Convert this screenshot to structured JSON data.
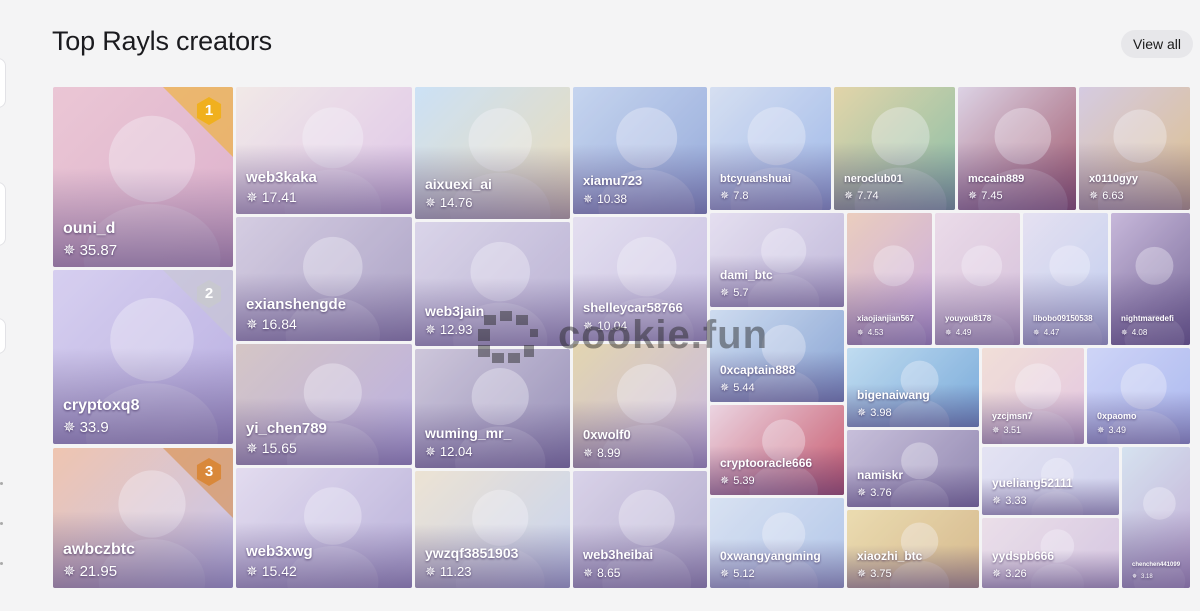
{
  "header": {
    "title": "Top Rayls creators",
    "view_all_label": "View all"
  },
  "watermark": {
    "text": "cookie.fun"
  },
  "ranks": {
    "first": "1",
    "second": "2",
    "third": "3"
  },
  "icons": {
    "score": "cog-icon"
  },
  "colors": {
    "tile_tint": "#c9b8ee",
    "gold": "#f0b01e",
    "silver": "#c8c8d0",
    "bronze": "#d9883a"
  },
  "creators": [
    {
      "name": "ouni_d",
      "score": "35.87"
    },
    {
      "name": "cryptoxq8",
      "score": "33.9"
    },
    {
      "name": "awbczbtc",
      "score": "21.95"
    },
    {
      "name": "web3kaka",
      "score": "17.41"
    },
    {
      "name": "exianshengde",
      "score": "16.84"
    },
    {
      "name": "yi_chen789",
      "score": "15.65"
    },
    {
      "name": "web3xwg",
      "score": "15.42"
    },
    {
      "name": "aixuexi_ai",
      "score": "14.76"
    },
    {
      "name": "web3jain",
      "score": "12.93"
    },
    {
      "name": "wuming_mr_",
      "score": "12.04"
    },
    {
      "name": "ywzqf3851903",
      "score": "11.23"
    },
    {
      "name": "xiamu723",
      "score": "10.38"
    },
    {
      "name": "shelleycar58766",
      "score": "10.04"
    },
    {
      "name": "0xwolf0",
      "score": "8.99"
    },
    {
      "name": "web3heibai",
      "score": "8.65"
    },
    {
      "name": "btcyuanshuai",
      "score": "7.8"
    },
    {
      "name": "dami_btc",
      "score": "5.7"
    },
    {
      "name": "0xcaptain888",
      "score": "5.44"
    },
    {
      "name": "cryptooracle666",
      "score": "5.39"
    },
    {
      "name": "0xwangyangming",
      "score": "5.12"
    },
    {
      "name": "neroclub01",
      "score": "7.74"
    },
    {
      "name": "mccain889",
      "score": "7.45"
    },
    {
      "name": "x0110gyy",
      "score": "6.63"
    },
    {
      "name": "xiaojianjian567",
      "score": "4.53"
    },
    {
      "name": "youyou8178",
      "score": "4.49"
    },
    {
      "name": "libobo09150538",
      "score": "4.47"
    },
    {
      "name": "nightmaredefi",
      "score": "4.08"
    },
    {
      "name": "bigenaiwang",
      "score": "3.98"
    },
    {
      "name": "yzcjmsn7",
      "score": "3.51"
    },
    {
      "name": "0xpaomo",
      "score": "3.49"
    },
    {
      "name": "namiskr",
      "score": "3.76"
    },
    {
      "name": "yueliang52111",
      "score": "3.33"
    },
    {
      "name": "xiaozhi_btc",
      "score": "3.75"
    },
    {
      "name": "yydspb666",
      "score": "3.26"
    },
    {
      "name": "chenchen441099",
      "score": "3.18"
    }
  ]
}
